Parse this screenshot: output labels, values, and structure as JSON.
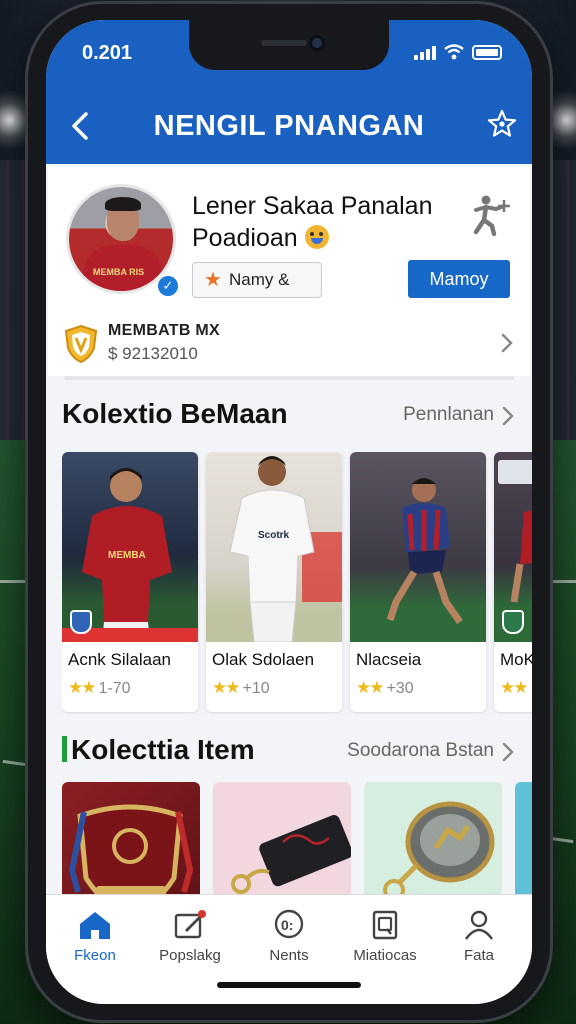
{
  "status_bar": {
    "time": "0.201"
  },
  "header": {
    "title": "NENGIL PNANGAN"
  },
  "profile": {
    "name_line1": "Lener Sakaa Panalan",
    "name_line2": "Poadioan",
    "tag_label": "Namy &",
    "primary_button": "Mamoy",
    "avatar_shirt_text": "MEMBA RIS",
    "member_title": "MEMBATB MX",
    "member_value": "$ 92132010"
  },
  "players_section": {
    "title": "Kolextio BeMaan",
    "link": "Pennlanan",
    "cards": [
      {
        "name": "Acnk Silalaan",
        "rating": "1-70",
        "stars": "★★"
      },
      {
        "name": "Olak Sdolaen",
        "rating": "+10",
        "stars": "★★"
      },
      {
        "name": "Nlacseia",
        "rating": "+30",
        "stars": "★★"
      },
      {
        "name": "MoKa",
        "rating": "",
        "stars": "★★"
      }
    ]
  },
  "items_section": {
    "title": "Kolecttia Item",
    "link": "Soodarona Bstan"
  },
  "tabbar": {
    "tabs": [
      {
        "label": "Fkeon",
        "icon": "home-icon"
      },
      {
        "label": "Popslakg",
        "icon": "edit-icon"
      },
      {
        "label": "Nents",
        "icon": "chat-icon"
      },
      {
        "label": "Miatiocas",
        "icon": "document-icon"
      },
      {
        "label": "Fata",
        "icon": "profile-icon"
      }
    ]
  },
  "colors": {
    "brand_blue": "#1960c0",
    "button_blue": "#1868c8",
    "star_gold": "#f0b91c",
    "accent_green": "#1f9a3c"
  }
}
